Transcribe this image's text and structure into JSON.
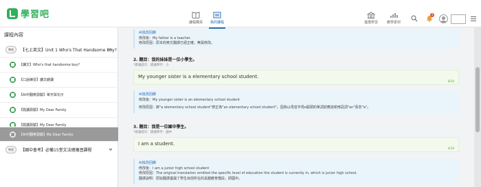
{
  "app": {
    "logo_text": "學習吧"
  },
  "nav": {
    "tabs": [
      {
        "label": "課程購買",
        "icon": "book-icon"
      },
      {
        "label": "我的課程",
        "icon": "courses-icon"
      }
    ],
    "tools": [
      {
        "label": "進階學習",
        "icon": "school-icon"
      },
      {
        "label": "教學素材",
        "icon": "chart-icon"
      }
    ],
    "notification_count": "3"
  },
  "sidebar": {
    "title": "課程內容",
    "units": [
      {
        "badge": "學習",
        "label": "【七上英文】Unit 1 Who's That Handsome Boy?"
      },
      {
        "badge": "學習",
        "label": "【國中會考】必備15堂文法總複習課程"
      }
    ],
    "lessons": [
      {
        "label": "【課文】Who's that handsome boy？"
      },
      {
        "label": "【口說練習】課文朗讀"
      },
      {
        "label": "【AI中翻英測驗】單字與句子"
      },
      {
        "label": "【閱讀測驗】My Dear Family"
      },
      {
        "label": "【閱讀測驗】My Dear Family"
      },
      {
        "label": "【AI中翻英測驗】My Dear Family"
      }
    ]
  },
  "main": {
    "feedback_1": {
      "title": "AI批改回饋",
      "line1": "修改後：My father is a teacher.",
      "line2": "修改原因：原本的英文翻譯已經正確，無需修改。"
    },
    "q2": {
      "title": "2. 題目：我的妹妹是一位小學生。",
      "hint": "*建議提示：建議單字：小",
      "answer": "My younger sister is a elementary school student.",
      "score": "8/10"
    },
    "feedback_2": {
      "title": "AI批改回饋",
      "line1": "修改後：My younger sister is an elementary school student",
      "line2": "修改原因：將\"a elementary school student\"修正為\"an elementary school student\"，因為以母音字母e開頭的單詞前應該使用冠詞\"an\"而非\"a\"。"
    },
    "q3": {
      "title": "3. 題目：我是一位國中學生。",
      "hint": "*建議提示：建議單字：國中",
      "answer": "I am a student.",
      "score": "4/10"
    },
    "feedback_3": {
      "title": "AI批改回饋",
      "line1": "修改後：I am a junior high school student",
      "line2": "修改原因：The original translation omitted the specific level of education the student is currently in, which is junior high school.",
      "line3": "翻譯說明：原始翻譯遺漏了學生目前所在的具體教育階段，即國中。"
    }
  },
  "colors": {
    "brand": "#2fb15a",
    "accent": "#2a6fb8",
    "active_lesson": "#9a9a9a",
    "badge_red": "#e94b3c"
  }
}
